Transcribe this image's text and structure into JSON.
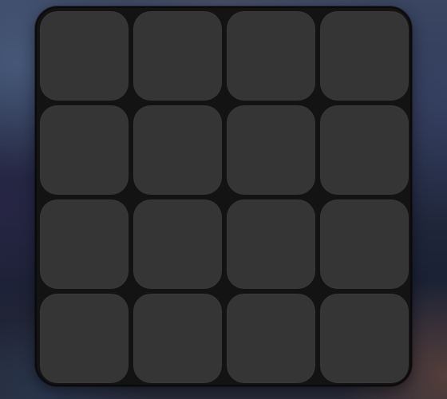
{
  "panel": {
    "background_color": "#131313",
    "tile_color": "#353535",
    "rows": 4,
    "columns": 4,
    "tiles": [
      {
        "row": 1,
        "column": 1
      },
      {
        "row": 1,
        "column": 2
      },
      {
        "row": 1,
        "column": 3
      },
      {
        "row": 1,
        "column": 4
      },
      {
        "row": 2,
        "column": 1
      },
      {
        "row": 2,
        "column": 2
      },
      {
        "row": 2,
        "column": 3
      },
      {
        "row": 2,
        "column": 4
      },
      {
        "row": 3,
        "column": 1
      },
      {
        "row": 3,
        "column": 2
      },
      {
        "row": 3,
        "column": 3
      },
      {
        "row": 3,
        "column": 4
      },
      {
        "row": 4,
        "column": 1
      },
      {
        "row": 4,
        "column": 2
      },
      {
        "row": 4,
        "column": 3
      },
      {
        "row": 4,
        "column": 4
      }
    ]
  }
}
